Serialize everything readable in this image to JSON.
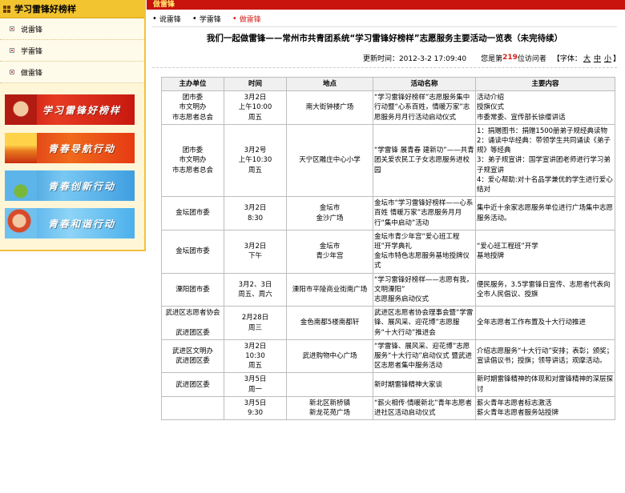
{
  "sidebar": {
    "title": "学习雷锋好榜样",
    "items": [
      {
        "label": "说雷锋"
      },
      {
        "label": "学雷锋"
      },
      {
        "label": "做雷锋"
      }
    ],
    "banners": [
      {
        "label": "学习雷锋好榜样"
      },
      {
        "label": "青春导航行动"
      },
      {
        "label": "青春创新行动"
      },
      {
        "label": "青春和谐行动"
      }
    ]
  },
  "topbar": {
    "title": "做雷锋"
  },
  "subnav": [
    {
      "label": "说雷锋"
    },
    {
      "label": "学雷锋"
    },
    {
      "label": "做雷锋"
    }
  ],
  "page": {
    "title": "我们一起做雷锋——常州市共青团系统“学习雷锋好榜样”志愿服务主要活动一览表（未完待续）",
    "update_label": "更新时间：2012-3-2 17:09:40",
    "visitor_prefix": "您是第",
    "visitor_count": "219",
    "visitor_suffix": "位访问者",
    "font_prefix": "【字体：",
    "font_large": "大",
    "font_medium": "中",
    "font_small": "小",
    "font_suffix": "】"
  },
  "table": {
    "headers": [
      "主办单位",
      "时间",
      "地点",
      "活动名称",
      "主要内容"
    ],
    "rows": [
      {
        "org": [
          "团市委",
          "市文明办",
          "市志愿者总会"
        ],
        "time": [
          "3月2日",
          "上午10:00",
          "周五"
        ],
        "place": [
          "南大街钟楼广场"
        ],
        "name": [
          "“学习雷锋好榜样”志愿服务集中行动暨“心系百姓，情暖万家”志愿服务月月行活动启动仪式"
        ],
        "content": [
          "活动介绍",
          "授旗仪式",
          "市委常委、宣传部长徐缨讲话"
        ]
      },
      {
        "org": [
          "团市委",
          "市文明办",
          "市志愿者总会"
        ],
        "time": [
          "3月2号",
          "上午10:30",
          "周五"
        ],
        "place": [
          "天宁区雕庄中心小学"
        ],
        "name": [
          "“学雷锋 展青春 建新功”——共青团关爱农民工子女志愿服务进校园"
        ],
        "content": [
          "1：捐赠图书：捐赠1500册弟子规经典读物",
          "2：诵读中华经典：带领学生共同诵读《弟子规》等经典",
          "3：弟子规宣讲：国学宣讲团老师进行学习弟子规宣讲",
          "4：爱心帮助:对十名品学兼优的学生进行爱心结对"
        ]
      },
      {
        "org": [
          "金坛团市委"
        ],
        "time": [
          "3月2日",
          "8:30"
        ],
        "place": [
          "金坛市",
          "金沙广场"
        ],
        "name": [
          "金坛市“学习雷锋好榜样——心系百姓 情暖万家”志愿服务月月行“集中启动”活动"
        ],
        "content": [
          "集中近十余家志愿服务单位进行广场集中志愿服务活动。"
        ]
      },
      {
        "org": [
          "金坛团市委"
        ],
        "time": [
          "3月2日",
          "下午"
        ],
        "place": [
          "金坛市",
          "青少年宫"
        ],
        "name": [
          "金坛市青少年宫“爱心班工程班”开学典礼",
          "金坛市特色志愿服务基地授牌仪式"
        ],
        "content": [
          "“爱心班工程班”开学",
          "基地授牌"
        ]
      },
      {
        "org": [
          "溧阳团市委"
        ],
        "time": [
          "3月2、3日",
          "周五、周六"
        ],
        "place": [
          "溧阳市平陵商业街南广场"
        ],
        "name": [
          "“学习雷锋好榜样——志愿有我，文明溧阳”",
          "志愿服务启动仪式"
        ],
        "content": [
          "便民服务，3.5学雷锋日宣传、志愿者代表向全市人民倡议、授旗"
        ]
      },
      {
        "org": [
          "武进区志愿者协会",
          "",
          "武进团区委"
        ],
        "time": [
          "2月28日",
          "周三"
        ],
        "place": [
          "金色南都5楼南都轩"
        ],
        "name": [
          "武进区志愿者协会理事会暨“学雷锋、展风采、迎花博”志愿服务“十大行动”推进会"
        ],
        "content": [
          "全年志愿者工作布置及十大行动推进"
        ]
      },
      {
        "org": [
          "武进区文明办",
          "武进团区委"
        ],
        "time": [
          "3月2日",
          "10:30",
          "周五"
        ],
        "place": [
          "武进购物中心广场"
        ],
        "name": [
          "“学雷锋、展风采、迎花博”志愿服务“十大行动”启动仪式 暨武进区志愿者集中服务活动"
        ],
        "content": [
          "介绍志愿服务“十大行动”安排；表彰；颁奖；宣读倡议书；授旗；领导讲话；观摩活动。"
        ]
      },
      {
        "org": [
          "武进团区委"
        ],
        "time": [
          "3月5日",
          "周一"
        ],
        "place": [
          ""
        ],
        "name": [
          "新时期雷锋精神大家谈"
        ],
        "content": [
          "新时期雷锋精神的体现和对雷锋精神的深层探讨"
        ]
      },
      {
        "org": [
          ""
        ],
        "time": [
          "3月5日",
          "9:30"
        ],
        "place": [
          "新北区新桥镇",
          "新龙花苑广场"
        ],
        "name": [
          "“薪火相传·情暖新北”青年志愿者进社区活动启动仪式"
        ],
        "content": [
          "薪火青年志愿者标志激活",
          "薪火青年志愿者服务站授牌"
        ]
      }
    ]
  },
  "colors": {
    "topbar_bg": "#c8140d",
    "sidebar_header_bg": "#f2c430",
    "sidebar_bg": "#fff6d8",
    "accent_red": "#d02018"
  }
}
